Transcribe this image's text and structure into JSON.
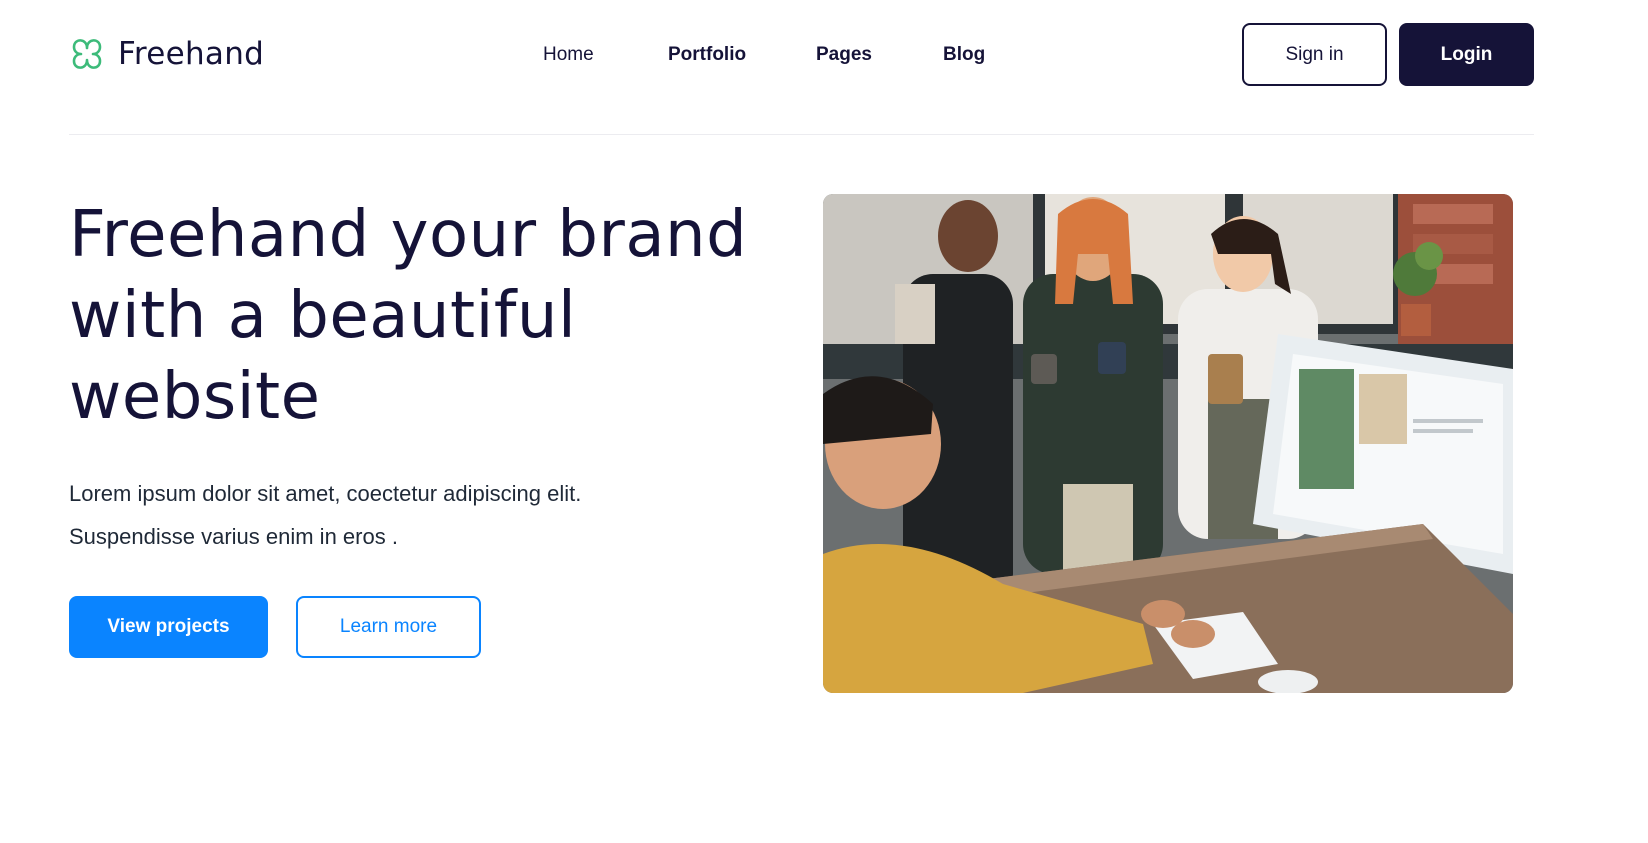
{
  "header": {
    "brand": {
      "name": "Freehand",
      "icon": "clover-icon",
      "icon_color": "#3dbb7a"
    },
    "nav": [
      {
        "label": "Home"
      },
      {
        "label": "Portfolio"
      },
      {
        "label": "Pages"
      },
      {
        "label": "Blog"
      }
    ],
    "actions": {
      "signin_label": "Sign in",
      "login_label": "Login"
    }
  },
  "hero": {
    "title": "Freehand your brand with a beautiful website",
    "paragraph_line1": "Lorem ipsum dolor sit amet, coectetur adipiscing elit.",
    "paragraph_line2": "Suspendisse varius enim in eros .",
    "primary_button": "View projects",
    "secondary_button": "Learn more",
    "image": "office-team-photo"
  },
  "colors": {
    "navy": "#151338",
    "accent_blue": "#0a84ff",
    "brand_green": "#3dbb7a"
  }
}
